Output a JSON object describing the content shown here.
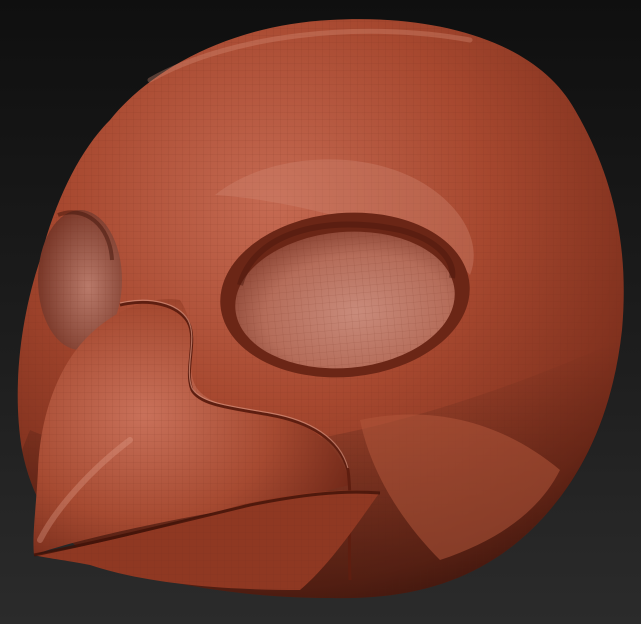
{
  "scene": {
    "subject_icon": "bird-head-sculpt-icon",
    "colors": {
      "background_top": "#0f0f0f",
      "background_bottom": "#2b2b2b",
      "clay_base": "#a7482f",
      "clay_highlight": "#d98a73",
      "clay_shadow": "#5a1d10",
      "wireframe": "#6e2a1a"
    }
  }
}
